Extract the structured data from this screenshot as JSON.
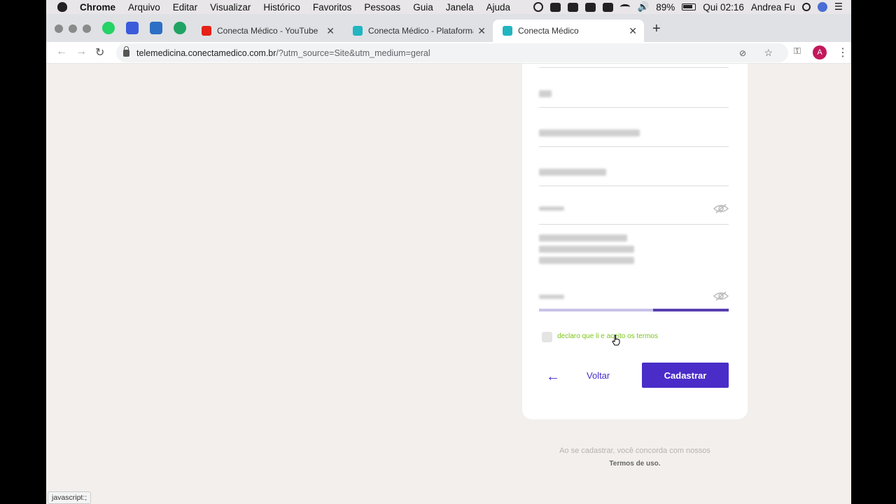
{
  "menubar": {
    "app": "Chrome",
    "items": [
      "Arquivo",
      "Editar",
      "Visualizar",
      "Histórico",
      "Favoritos",
      "Pessoas",
      "Guia",
      "Janela",
      "Ajuda"
    ],
    "battery": "89%",
    "clock": "Qui 02:16",
    "user": "Andrea Fu"
  },
  "tabs": [
    {
      "title": "Conecta Médico - YouTube",
      "icon": "youtube-icon",
      "color": "#e62117"
    },
    {
      "title": "Conecta Médico - Plataforma c",
      "icon": "conecta-icon",
      "color": "#21b5c2"
    },
    {
      "title": "Conecta Médico",
      "icon": "conecta-icon",
      "color": "#21b5c2",
      "active": true
    }
  ],
  "address": {
    "host": "telemedicina.conectamedico.com.br",
    "path": "/?utm_source=Site&utm_medium=geral"
  },
  "profile_initial": "A",
  "form": {
    "terms_checkbox_label": "declaro que li e aceito os termos",
    "back_label": "Voltar",
    "submit_label": "Cadastrar",
    "footer_text": "Ao se cadastrar, você concorda com nossos",
    "footer_link": "Termos de uso.",
    "password_strength": 0.6
  },
  "status_bar": "javascript:;",
  "colors": {
    "primary": "#4a2dc8",
    "terms_green": "#7bc618",
    "page_bg": "#f3efec"
  }
}
